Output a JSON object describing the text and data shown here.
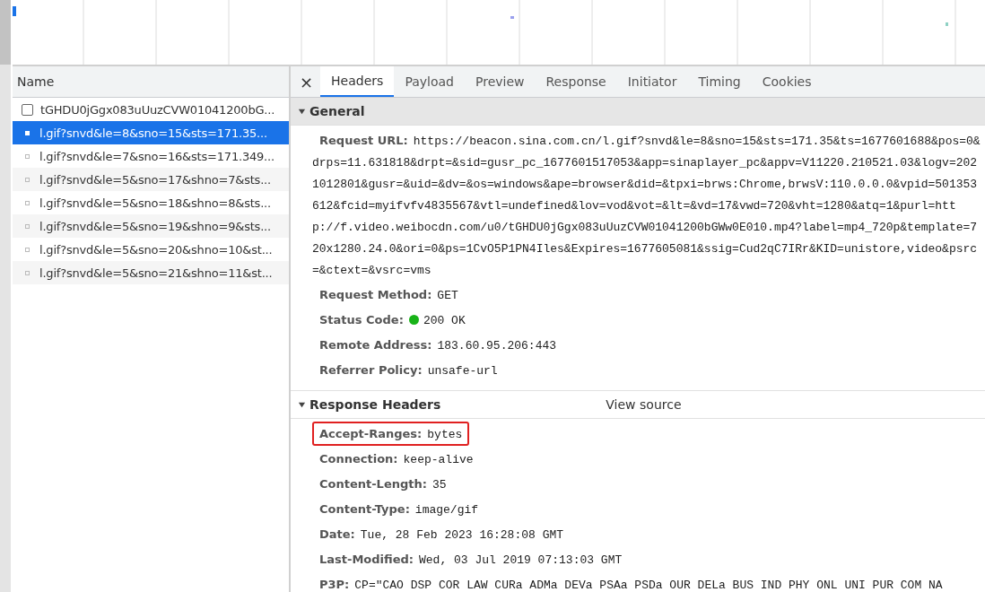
{
  "requests": {
    "column": "Name",
    "rows": [
      {
        "kind": "document",
        "name": "tGHDU0jGgx083uUuzCVW01041200bG...",
        "selected": false
      },
      {
        "kind": "image",
        "name": "l.gif?snvd&le=8&sno=15&sts=171.35...",
        "selected": true
      },
      {
        "kind": "image",
        "name": "l.gif?snvd&le=7&sno=16&sts=171.349...",
        "selected": false
      },
      {
        "kind": "image",
        "name": "l.gif?snvd&le=5&sno=17&shno=7&sts...",
        "selected": false
      },
      {
        "kind": "image",
        "name": "l.gif?snvd&le=5&sno=18&shno=8&sts...",
        "selected": false
      },
      {
        "kind": "image",
        "name": "l.gif?snvd&le=5&sno=19&shno=9&sts...",
        "selected": false
      },
      {
        "kind": "image",
        "name": "l.gif?snvd&le=5&sno=20&shno=10&st...",
        "selected": false
      },
      {
        "kind": "image",
        "name": "l.gif?snvd&le=5&sno=21&shno=11&st...",
        "selected": false
      }
    ]
  },
  "close": "×",
  "tabs": [
    {
      "label": "Headers",
      "selected": true
    },
    {
      "label": "Payload",
      "selected": false
    },
    {
      "label": "Preview",
      "selected": false
    },
    {
      "label": "Response",
      "selected": false
    },
    {
      "label": "Initiator",
      "selected": false
    },
    {
      "label": "Timing",
      "selected": false
    },
    {
      "label": "Cookies",
      "selected": false
    }
  ],
  "sections": [
    {
      "title": "General",
      "expanded": true,
      "shaded": true,
      "fields": [
        {
          "name": "Request URL:",
          "value": "https://beacon.sina.com.cn/l.gif?snvd&le=8&sno=15&sts=171.35&ts=1677601688&pos=0&drps=11.631818&drpt=&sid=gusr_pc_1677601517053&app=sinaplayer_pc&appv=V11220.210521.03&logv=2021012801&gusr=&uid=&dv=&os=windows&ape=browser&did=&tpxi=brws:Chrome,brwsV:110.0.0.0&vpid=501353612&fcid=myifvfv4835567&vtl=undefined&lov=vod&vot=&lt=&vd=17&vwd=720&vht=1280&atq=1&purl=http://f.video.weibocdn.com/u0/tGHDU0jGgx083uUuzCVW01041200bGWw0E010.mp4?label=mp4_720p&template=720x1280.24.0&ori=0&ps=1CvO5P1PN4Iles&Expires=1677605081&ssig=Cud2qC7IRr&KID=unistore,video&psrc=&ctext=&vsrc=vms",
          "status": false,
          "highlighted": false
        },
        {
          "name": "Request Method:",
          "value": "GET",
          "status": false,
          "highlighted": false
        },
        {
          "name": "Status Code:",
          "value": "200 OK",
          "status": true,
          "highlighted": false
        },
        {
          "name": "Remote Address:",
          "value": "183.60.95.206:443",
          "status": false,
          "highlighted": false
        },
        {
          "name": "Referrer Policy:",
          "value": "unsafe-url",
          "status": false,
          "highlighted": false
        }
      ]
    },
    {
      "title": "Response Headers",
      "expanded": true,
      "shaded": false,
      "link": "View source",
      "fields": [
        {
          "name": "Accept-Ranges:",
          "value": "bytes",
          "status": false,
          "highlighted": true
        },
        {
          "name": "Connection:",
          "value": "keep-alive",
          "status": false,
          "highlighted": false
        },
        {
          "name": "Content-Length:",
          "value": "35",
          "status": false,
          "highlighted": false
        },
        {
          "name": "Content-Type:",
          "value": "image/gif",
          "status": false,
          "highlighted": false
        },
        {
          "name": "Date:",
          "value": "Tue, 28 Feb 2023 16:28:08 GMT",
          "status": false,
          "highlighted": false
        },
        {
          "name": "Last-Modified:",
          "value": "Wed, 03 Jul 2019 07:13:03 GMT",
          "status": false,
          "highlighted": false
        },
        {
          "name": "P3P:",
          "value": "CP=\"CAO DSP COR LAW CURa ADMa DEVa PSAa PSDa OUR DELa BUS IND PHY ONL UNI PUR COM NA",
          "status": false,
          "highlighted": false
        }
      ]
    }
  ]
}
